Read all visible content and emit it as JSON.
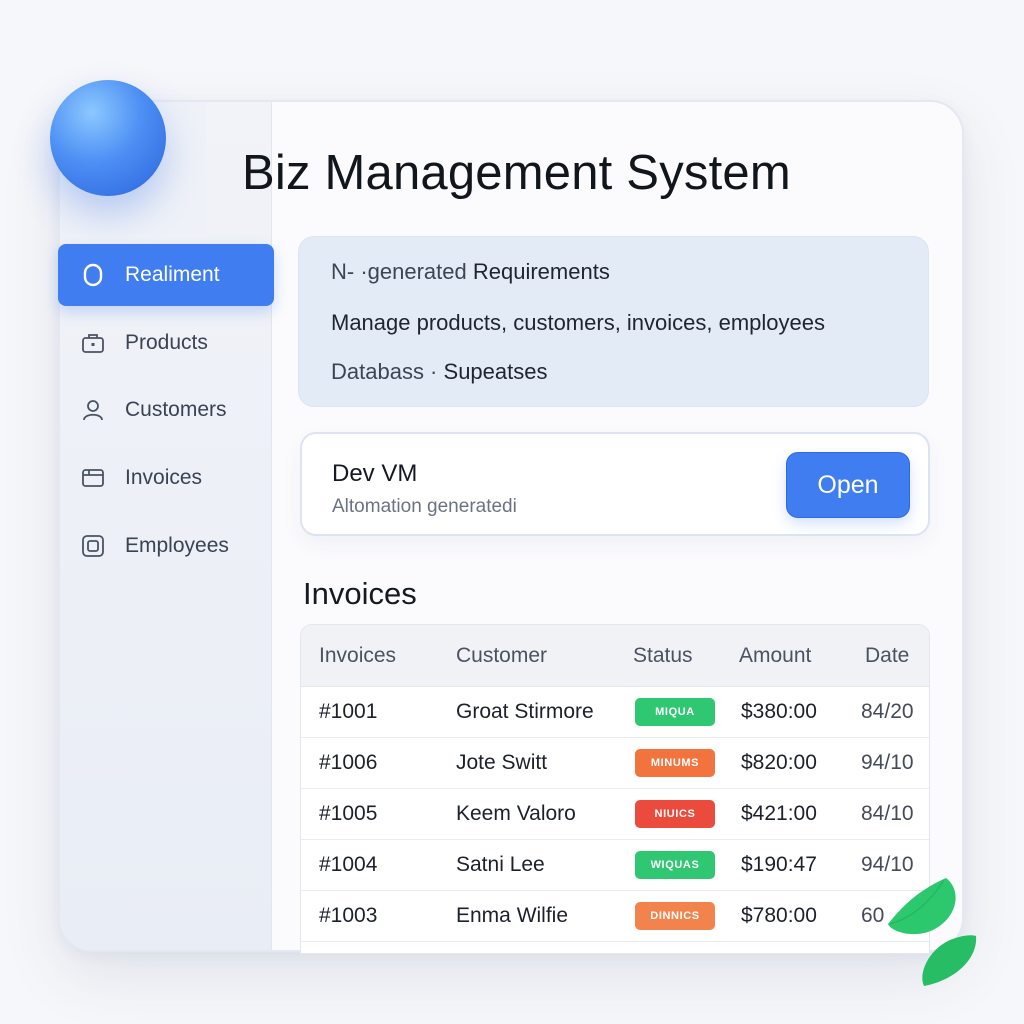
{
  "app": {
    "title": "Biz Management System"
  },
  "sidebar": {
    "items": [
      {
        "label": "Realiment",
        "icon": "circle-icon",
        "active": true
      },
      {
        "label": "Products",
        "icon": "briefcase-icon"
      },
      {
        "label": "Customers",
        "icon": "user-icon"
      },
      {
        "label": "Invoices",
        "icon": "invoice-icon"
      },
      {
        "label": "Employees",
        "icon": "employees-icon"
      }
    ]
  },
  "requirements": {
    "heading_prefix": "N- ·generated",
    "heading_strong": "Requirements",
    "summary": "Manage products, customers,  invoices, employees",
    "database_label": "Databass ·",
    "database_value": "Supeatses"
  },
  "dev_vm": {
    "title": "Dev VM",
    "subtitle": "Altomation  generatedi",
    "button_label": "Open"
  },
  "invoices": {
    "section_title": "Invoices",
    "columns": [
      "Invoices",
      "Customer",
      "Status",
      "Amount",
      "Date"
    ],
    "rows": [
      {
        "invoice": "#1001",
        "customer": "Groat Stirmore",
        "status": "MIQUA",
        "status_color": "#2fc772",
        "amount": "$380:00",
        "date": "84/20"
      },
      {
        "invoice": "#1006",
        "customer": "Jote Switt",
        "status": "MINUMS",
        "status_color": "#f2733d",
        "amount": "$820:00",
        "date": "94/10"
      },
      {
        "invoice": "#1005",
        "customer": "Keem Valoro",
        "status": "NIUICS",
        "status_color": "#ea4b3c",
        "amount": "$421:00",
        "date": "84/10"
      },
      {
        "invoice": "#1004",
        "customer": "Satni Lee",
        "status": "WIQUAS",
        "status_color": "#2fc772",
        "amount": "$190:47",
        "date": "94/10"
      },
      {
        "invoice": "#1003",
        "customer": "Enma Wilfie",
        "status": "DINNICS",
        "status_color": "#f2834d",
        "amount": "$780:00",
        "date": "60"
      }
    ]
  },
  "colors": {
    "accent": "#3f7df1",
    "orb": "#4d8ff4",
    "leaf": "#27c46a"
  }
}
